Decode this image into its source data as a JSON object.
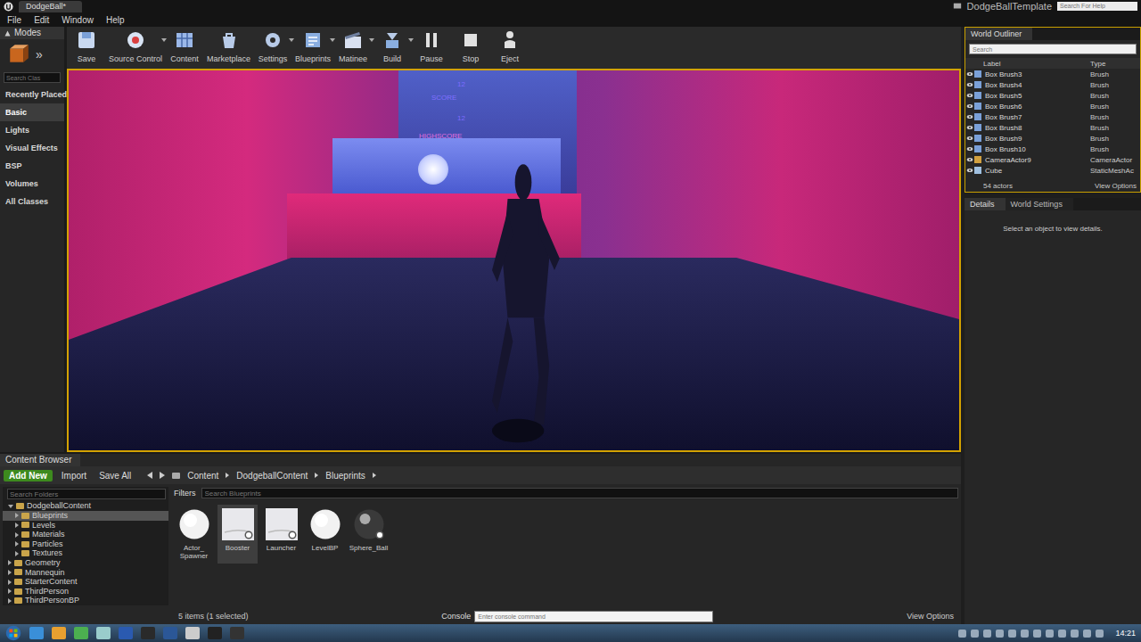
{
  "window": {
    "tab": "DodgeBall*",
    "project": "DodgeBallTemplate",
    "help_search": {
      "placeholder": "Search For Help"
    }
  },
  "menu": [
    "File",
    "Edit",
    "Window",
    "Help"
  ],
  "modes": {
    "title": "Modes",
    "expand": "»",
    "search": {
      "placeholder": "Search Clas"
    },
    "items": [
      {
        "label": "Recently Placed",
        "selected": false
      },
      {
        "label": "Basic",
        "selected": true
      },
      {
        "label": "Lights",
        "selected": false
      },
      {
        "label": "Visual Effects",
        "selected": false
      },
      {
        "label": "BSP",
        "selected": false
      },
      {
        "label": "Volumes",
        "selected": false
      },
      {
        "label": "All Classes",
        "selected": false
      }
    ]
  },
  "toolbar": [
    {
      "label": "Save",
      "kind": "save",
      "dropdown": false
    },
    {
      "label": "Source Control",
      "kind": "source",
      "dropdown": true
    },
    {
      "label": "Content",
      "kind": "content",
      "dropdown": false
    },
    {
      "label": "Marketplace",
      "kind": "market",
      "dropdown": false
    },
    {
      "label": "Settings",
      "kind": "settings",
      "dropdown": true
    },
    {
      "label": "Blueprints",
      "kind": "blueprints",
      "dropdown": true
    },
    {
      "label": "Matinee",
      "kind": "matinee",
      "dropdown": true
    },
    {
      "label": "Build",
      "kind": "build",
      "dropdown": true
    },
    {
      "label": "Pause",
      "kind": "pause",
      "dropdown": false
    },
    {
      "label": "Stop",
      "kind": "stop",
      "dropdown": false
    },
    {
      "label": "Eject",
      "kind": "eject",
      "dropdown": false
    }
  ],
  "viewport": {
    "hud": [
      {
        "value": "12",
        "label": "SCORE"
      },
      {
        "value": "12",
        "label": "HIGHSCORE"
      }
    ]
  },
  "outliner": {
    "title": "World Outliner",
    "search": {
      "placeholder": "Search"
    },
    "columns": [
      "Label",
      "Type"
    ],
    "rows": [
      {
        "label": "Box Brush3",
        "type": "Brush",
        "kind": "brush"
      },
      {
        "label": "Box Brush4",
        "type": "Brush",
        "kind": "brush"
      },
      {
        "label": "Box Brush5",
        "type": "Brush",
        "kind": "brush"
      },
      {
        "label": "Box Brush6",
        "type": "Brush",
        "kind": "brush"
      },
      {
        "label": "Box Brush7",
        "type": "Brush",
        "kind": "brush"
      },
      {
        "label": "Box Brush8",
        "type": "Brush",
        "kind": "brush"
      },
      {
        "label": "Box Brush9",
        "type": "Brush",
        "kind": "brush"
      },
      {
        "label": "Box Brush10",
        "type": "Brush",
        "kind": "brush"
      },
      {
        "label": "CameraActor9",
        "type": "CameraActor",
        "kind": "camera"
      },
      {
        "label": "Cube",
        "type": "StaticMeshAc",
        "kind": "mesh"
      }
    ],
    "count": "54 actors",
    "view_options": "View Options"
  },
  "details": {
    "tabs": [
      {
        "label": "Details",
        "selected": true
      },
      {
        "label": "World Settings",
        "selected": false
      }
    ],
    "message": "Select an object to view details."
  },
  "content_browser": {
    "title": "Content Browser",
    "buttons": {
      "add_new": "Add New",
      "import": "Import",
      "save_all": "Save All"
    },
    "path": [
      "Content",
      "DodgeballContent",
      "Blueprints"
    ],
    "folder_search": {
      "placeholder": "Search Folders"
    },
    "folders": [
      {
        "label": "DodgeballContent",
        "depth": 0,
        "expanded": true,
        "selected": false
      },
      {
        "label": "Blueprints",
        "depth": 1,
        "expanded": false,
        "selected": true
      },
      {
        "label": "Levels",
        "depth": 1,
        "expanded": false,
        "selected": false
      },
      {
        "label": "Materials",
        "depth": 1,
        "expanded": false,
        "selected": false
      },
      {
        "label": "Particles",
        "depth": 1,
        "expanded": false,
        "selected": false
      },
      {
        "label": "Textures",
        "depth": 1,
        "expanded": false,
        "selected": false
      },
      {
        "label": "Geometry",
        "depth": 0,
        "expanded": false,
        "selected": false
      },
      {
        "label": "Mannequin",
        "depth": 0,
        "expanded": false,
        "selected": false
      },
      {
        "label": "StarterContent",
        "depth": 0,
        "expanded": false,
        "selected": false
      },
      {
        "label": "ThirdPerson",
        "depth": 0,
        "expanded": false,
        "selected": false
      },
      {
        "label": "ThirdPersonBP",
        "depth": 0,
        "expanded": false,
        "selected": false
      }
    ],
    "filters": "Filters",
    "asset_search": {
      "placeholder": "Search Blueprints"
    },
    "assets": [
      {
        "label": "Actor_\nSpawner",
        "kind": "sphere",
        "selected": false
      },
      {
        "label": "Booster",
        "kind": "blueprint",
        "selected": true
      },
      {
        "label": "Launcher",
        "kind": "blueprint",
        "selected": false
      },
      {
        "label": "LevelBP",
        "kind": "sphere",
        "selected": false
      },
      {
        "label": "Sphere_Ball",
        "kind": "ball",
        "selected": false
      }
    ],
    "status": "5 items (1 selected)",
    "console": {
      "label": "Console",
      "placeholder": "Enter console command"
    },
    "view_options": "View Options"
  },
  "taskbar": {
    "time": "14:21"
  }
}
